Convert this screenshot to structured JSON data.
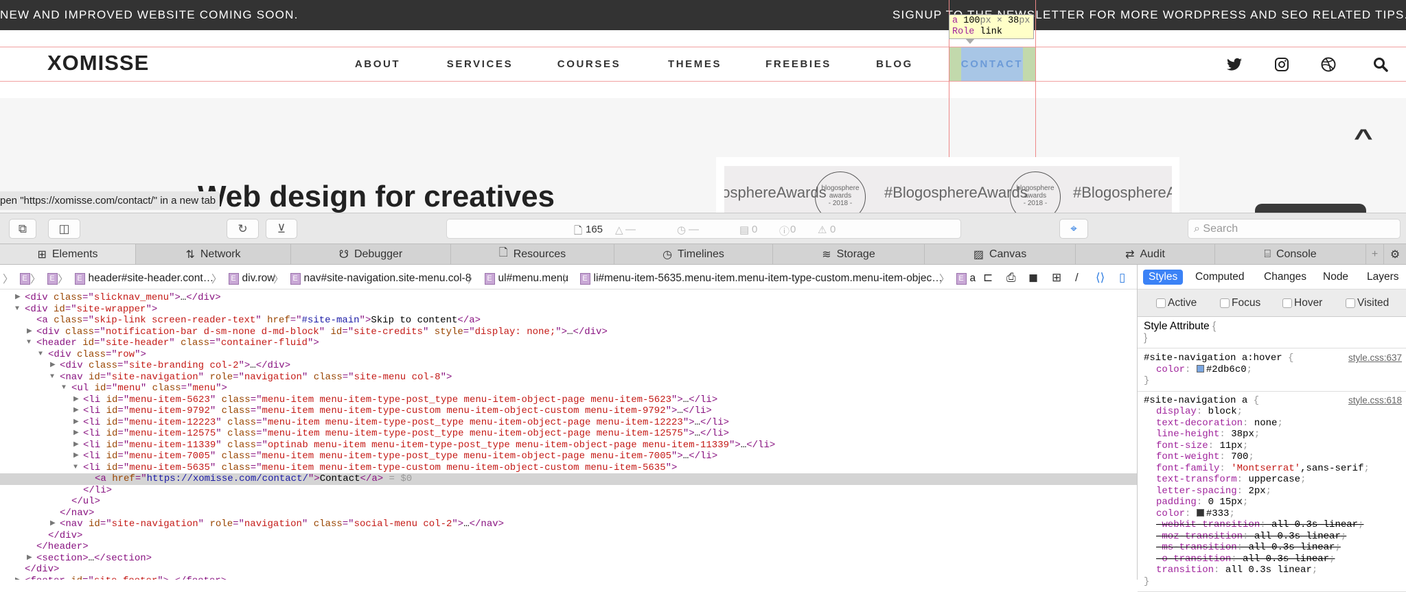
{
  "site": {
    "announcement": "NEW AND IMPROVED WEBSITE COMING SOON.",
    "newsletter": "SIGNUP TO THE NEWSLETTER FOR MORE WORDPRESS AND SEO RELATED TIPS...",
    "logo": "XOMISSE",
    "nav": [
      "ABOUT",
      "SERVICES",
      "COURSES",
      "THEMES",
      "FREEBIES",
      "BLOG",
      "CONTACT"
    ],
    "social_icons": [
      "twitter-icon",
      "instagram-icon",
      "dribbble-icon",
      "search-icon"
    ],
    "hero_title": "Web design for creatives",
    "banner_text": "#BlogosphereAwards",
    "seal_text": [
      "blogosphere",
      "awards",
      "- 2018 -"
    ],
    "status_bar": "pen \"https://xomisse.com/contact/\" in a new tab"
  },
  "inspector_tooltip": {
    "tag": "a",
    "width": "100",
    "height": "38",
    "unit": "px",
    "times": "×",
    "role_label": "Role",
    "role": "link"
  },
  "toolbar": {
    "resource_count": "165",
    "dash1": "—",
    "dash2": "—",
    "messages": "0",
    "errors": "0",
    "warnings": "0",
    "search_placeholder": "Search"
  },
  "tabs": [
    "Elements",
    "Network",
    "Debugger",
    "Resources",
    "Timelines",
    "Storage",
    "Canvas",
    "Audit",
    "Console"
  ],
  "breadcrumbs": [
    "",
    "",
    "header#site-header.cont…",
    "div.row",
    "nav#site-navigation.site-menu.col-8",
    "ul#menu.menu",
    "li#menu-item-5635.menu-item.menu-item-type-custom.menu-item-objec…",
    "a"
  ],
  "dom_tree": [
    {
      "depth": 1,
      "arrow": "▶",
      "parts": [
        [
          "tag",
          "<div "
        ],
        [
          "an",
          "class"
        ],
        [
          "tag",
          "=\""
        ],
        [
          "av",
          "slicknav_menu"
        ],
        [
          "tag",
          "\">"
        ],
        [
          "tx",
          "…"
        ],
        [
          "tag",
          "</div>"
        ]
      ]
    },
    {
      "depth": 1,
      "arrow": "▼",
      "parts": [
        [
          "tag",
          "<div "
        ],
        [
          "an",
          "id"
        ],
        [
          "tag",
          "=\""
        ],
        [
          "av",
          "site-wrapper"
        ],
        [
          "tag",
          "\">"
        ]
      ]
    },
    {
      "depth": 2,
      "arrow": "",
      "parts": [
        [
          "tag",
          "<a "
        ],
        [
          "an",
          "class"
        ],
        [
          "tag",
          "=\""
        ],
        [
          "av",
          "skip-link screen-reader-text"
        ],
        [
          "tag",
          "\" "
        ],
        [
          "an",
          "href"
        ],
        [
          "tag",
          "=\""
        ],
        [
          "lk",
          "#site-main"
        ],
        [
          "tag",
          "\">"
        ],
        [
          "tx",
          "Skip to content"
        ],
        [
          "tag",
          "</a>"
        ]
      ]
    },
    {
      "depth": 2,
      "arrow": "▶",
      "parts": [
        [
          "tag",
          "<div "
        ],
        [
          "an",
          "class"
        ],
        [
          "tag",
          "=\""
        ],
        [
          "av",
          "notification-bar d-sm-none d-md-block"
        ],
        [
          "tag",
          "\" "
        ],
        [
          "an",
          "id"
        ],
        [
          "tag",
          "=\""
        ],
        [
          "av",
          "site-credits"
        ],
        [
          "tag",
          "\" "
        ],
        [
          "an",
          "style"
        ],
        [
          "tag",
          "=\""
        ],
        [
          "av",
          "display: none;"
        ],
        [
          "tag",
          "\">"
        ],
        [
          "tx",
          "…"
        ],
        [
          "tag",
          "</div>"
        ]
      ]
    },
    {
      "depth": 2,
      "arrow": "▼",
      "parts": [
        [
          "tag",
          "<header "
        ],
        [
          "an",
          "id"
        ],
        [
          "tag",
          "=\""
        ],
        [
          "av",
          "site-header"
        ],
        [
          "tag",
          "\" "
        ],
        [
          "an",
          "class"
        ],
        [
          "tag",
          "=\""
        ],
        [
          "av",
          "container-fluid"
        ],
        [
          "tag",
          "\">"
        ]
      ]
    },
    {
      "depth": 3,
      "arrow": "▼",
      "parts": [
        [
          "tag",
          "<div "
        ],
        [
          "an",
          "class"
        ],
        [
          "tag",
          "=\""
        ],
        [
          "av",
          "row"
        ],
        [
          "tag",
          "\">"
        ]
      ]
    },
    {
      "depth": 4,
      "arrow": "▶",
      "parts": [
        [
          "tag",
          "<div "
        ],
        [
          "an",
          "class"
        ],
        [
          "tag",
          "=\""
        ],
        [
          "av",
          "site-branding col-2"
        ],
        [
          "tag",
          "\">"
        ],
        [
          "tx",
          "…"
        ],
        [
          "tag",
          "</div>"
        ]
      ]
    },
    {
      "depth": 4,
      "arrow": "▼",
      "parts": [
        [
          "tag",
          "<nav "
        ],
        [
          "an",
          "id"
        ],
        [
          "tag",
          "=\""
        ],
        [
          "av",
          "site-navigation"
        ],
        [
          "tag",
          "\" "
        ],
        [
          "an",
          "role"
        ],
        [
          "tag",
          "=\""
        ],
        [
          "av",
          "navigation"
        ],
        [
          "tag",
          "\" "
        ],
        [
          "an",
          "class"
        ],
        [
          "tag",
          "=\""
        ],
        [
          "av",
          "site-menu col-8"
        ],
        [
          "tag",
          "\">"
        ]
      ]
    },
    {
      "depth": 5,
      "arrow": "▼",
      "parts": [
        [
          "tag",
          "<ul "
        ],
        [
          "an",
          "id"
        ],
        [
          "tag",
          "=\""
        ],
        [
          "av",
          "menu"
        ],
        [
          "tag",
          "\" "
        ],
        [
          "an",
          "class"
        ],
        [
          "tag",
          "=\""
        ],
        [
          "av",
          "menu"
        ],
        [
          "tag",
          "\">"
        ]
      ]
    },
    {
      "depth": 6,
      "arrow": "▶",
      "parts": [
        [
          "tag",
          "<li "
        ],
        [
          "an",
          "id"
        ],
        [
          "tag",
          "=\""
        ],
        [
          "av",
          "menu-item-5623"
        ],
        [
          "tag",
          "\" "
        ],
        [
          "an",
          "class"
        ],
        [
          "tag",
          "=\""
        ],
        [
          "av",
          "menu-item menu-item-type-post_type menu-item-object-page menu-item-5623"
        ],
        [
          "tag",
          "\">"
        ],
        [
          "tx",
          "…"
        ],
        [
          "tag",
          "</li>"
        ]
      ]
    },
    {
      "depth": 6,
      "arrow": "▶",
      "parts": [
        [
          "tag",
          "<li "
        ],
        [
          "an",
          "id"
        ],
        [
          "tag",
          "=\""
        ],
        [
          "av",
          "menu-item-9792"
        ],
        [
          "tag",
          "\" "
        ],
        [
          "an",
          "class"
        ],
        [
          "tag",
          "=\""
        ],
        [
          "av",
          "menu-item menu-item-type-custom menu-item-object-custom menu-item-9792"
        ],
        [
          "tag",
          "\">"
        ],
        [
          "tx",
          "…"
        ],
        [
          "tag",
          "</li>"
        ]
      ]
    },
    {
      "depth": 6,
      "arrow": "▶",
      "parts": [
        [
          "tag",
          "<li "
        ],
        [
          "an",
          "id"
        ],
        [
          "tag",
          "=\""
        ],
        [
          "av",
          "menu-item-12223"
        ],
        [
          "tag",
          "\" "
        ],
        [
          "an",
          "class"
        ],
        [
          "tag",
          "=\""
        ],
        [
          "av",
          "menu-item menu-item-type-post_type menu-item-object-page menu-item-12223"
        ],
        [
          "tag",
          "\">"
        ],
        [
          "tx",
          "…"
        ],
        [
          "tag",
          "</li>"
        ]
      ]
    },
    {
      "depth": 6,
      "arrow": "▶",
      "parts": [
        [
          "tag",
          "<li "
        ],
        [
          "an",
          "id"
        ],
        [
          "tag",
          "=\""
        ],
        [
          "av",
          "menu-item-12575"
        ],
        [
          "tag",
          "\" "
        ],
        [
          "an",
          "class"
        ],
        [
          "tag",
          "=\""
        ],
        [
          "av",
          "menu-item menu-item-type-post_type menu-item-object-page menu-item-12575"
        ],
        [
          "tag",
          "\">"
        ],
        [
          "tx",
          "…"
        ],
        [
          "tag",
          "</li>"
        ]
      ]
    },
    {
      "depth": 6,
      "arrow": "▶",
      "parts": [
        [
          "tag",
          "<li "
        ],
        [
          "an",
          "id"
        ],
        [
          "tag",
          "=\""
        ],
        [
          "av",
          "menu-item-11339"
        ],
        [
          "tag",
          "\" "
        ],
        [
          "an",
          "class"
        ],
        [
          "tag",
          "=\""
        ],
        [
          "av",
          "optinab menu-item menu-item-type-post_type menu-item-object-page menu-item-11339"
        ],
        [
          "tag",
          "\">"
        ],
        [
          "tx",
          "…"
        ],
        [
          "tag",
          "</li>"
        ]
      ]
    },
    {
      "depth": 6,
      "arrow": "▶",
      "parts": [
        [
          "tag",
          "<li "
        ],
        [
          "an",
          "id"
        ],
        [
          "tag",
          "=\""
        ],
        [
          "av",
          "menu-item-7005"
        ],
        [
          "tag",
          "\" "
        ],
        [
          "an",
          "class"
        ],
        [
          "tag",
          "=\""
        ],
        [
          "av",
          "menu-item menu-item-type-post_type menu-item-object-page menu-item-7005"
        ],
        [
          "tag",
          "\">"
        ],
        [
          "tx",
          "…"
        ],
        [
          "tag",
          "</li>"
        ]
      ]
    },
    {
      "depth": 6,
      "arrow": "▼",
      "parts": [
        [
          "tag",
          "<li "
        ],
        [
          "an",
          "id"
        ],
        [
          "tag",
          "=\""
        ],
        [
          "av",
          "menu-item-5635"
        ],
        [
          "tag",
          "\" "
        ],
        [
          "an",
          "class"
        ],
        [
          "tag",
          "=\""
        ],
        [
          "av",
          "menu-item menu-item-type-custom menu-item-object-custom menu-item-5635"
        ],
        [
          "tag",
          "\">"
        ]
      ]
    },
    {
      "depth": 7,
      "arrow": "",
      "selected": true,
      "parts": [
        [
          "tag",
          "<a "
        ],
        [
          "an",
          "href"
        ],
        [
          "tag",
          "=\""
        ],
        [
          "lk",
          "https://xomisse.com/contact/"
        ],
        [
          "tag",
          "\">"
        ],
        [
          "tx",
          "Contact"
        ],
        [
          "tag",
          "</a>"
        ],
        [
          "dim",
          " = $0"
        ]
      ]
    },
    {
      "depth": 6,
      "arrow": "",
      "parts": [
        [
          "tag",
          "</li>"
        ]
      ]
    },
    {
      "depth": 5,
      "arrow": "",
      "parts": [
        [
          "tag",
          "</ul>"
        ]
      ]
    },
    {
      "depth": 4,
      "arrow": "",
      "parts": [
        [
          "tag",
          "</nav>"
        ]
      ]
    },
    {
      "depth": 4,
      "arrow": "▶",
      "parts": [
        [
          "tag",
          "<nav "
        ],
        [
          "an",
          "id"
        ],
        [
          "tag",
          "=\""
        ],
        [
          "av",
          "site-navigation"
        ],
        [
          "tag",
          "\" "
        ],
        [
          "an",
          "role"
        ],
        [
          "tag",
          "=\""
        ],
        [
          "av",
          "navigation"
        ],
        [
          "tag",
          "\" "
        ],
        [
          "an",
          "class"
        ],
        [
          "tag",
          "=\""
        ],
        [
          "av",
          "social-menu col-2"
        ],
        [
          "tag",
          "\">"
        ],
        [
          "tx",
          "…"
        ],
        [
          "tag",
          "</nav>"
        ]
      ]
    },
    {
      "depth": 3,
      "arrow": "",
      "parts": [
        [
          "tag",
          "</div>"
        ]
      ]
    },
    {
      "depth": 2,
      "arrow": "",
      "parts": [
        [
          "tag",
          "</header>"
        ]
      ]
    },
    {
      "depth": 2,
      "arrow": "▶",
      "parts": [
        [
          "tag",
          "<section>"
        ],
        [
          "tx",
          "…"
        ],
        [
          "tag",
          "</section>"
        ]
      ]
    },
    {
      "depth": 1,
      "arrow": "",
      "parts": [
        [
          "tag",
          "</div>"
        ]
      ]
    },
    {
      "depth": 1,
      "arrow": "▶",
      "parts": [
        [
          "tag",
          "<footer "
        ],
        [
          "an",
          "id"
        ],
        [
          "tag",
          "=\""
        ],
        [
          "av",
          "site-footer"
        ],
        [
          "tag",
          "\">"
        ],
        [
          "tx",
          "…"
        ],
        [
          "tag",
          "</footer>"
        ]
      ]
    }
  ],
  "sidebar": {
    "tabs": [
      "Styles",
      "Computed",
      "Changes",
      "Node",
      "Layers"
    ],
    "pseudo_classes": [
      "Active",
      "Focus",
      "Hover",
      "Visited"
    ],
    "style_attribute": "Style Attribute",
    "rules": [
      {
        "selector": "#site-navigation a:hover",
        "source": "style.css:637",
        "props": [
          {
            "name": "color",
            "value": "#2db6c0",
            "swatch": "#7aa6e0"
          }
        ]
      },
      {
        "selector": "#site-navigation a",
        "source": "style.css:618",
        "props": [
          {
            "name": "display",
            "value": "block"
          },
          {
            "name": "text-decoration",
            "value": "none"
          },
          {
            "name": "line-height",
            "value": "38px"
          },
          {
            "name": "font-size",
            "value": "11px"
          },
          {
            "name": "font-weight",
            "value": "700"
          },
          {
            "name": "font-family",
            "value": "'Montserrat'",
            "value2": ",sans-serif"
          },
          {
            "name": "text-transform",
            "value": "uppercase"
          },
          {
            "name": "letter-spacing",
            "value": "2px"
          },
          {
            "name": "padding",
            "value": "0 15px"
          },
          {
            "name": "color",
            "value": "#333",
            "swatch": "#333333"
          },
          {
            "name": "-webkit-transition",
            "value": "all 0.3s linear",
            "overridden": true
          },
          {
            "name": "-moz-transition",
            "value": "all 0.3s linear",
            "overridden": true
          },
          {
            "name": "-ms-transition",
            "value": "all 0.3s linear",
            "overridden": true
          },
          {
            "name": "-o-transition",
            "value": "all 0.3s linear",
            "overridden": true
          },
          {
            "name": "transition",
            "value": "all 0.3s linear"
          }
        ]
      }
    ]
  }
}
